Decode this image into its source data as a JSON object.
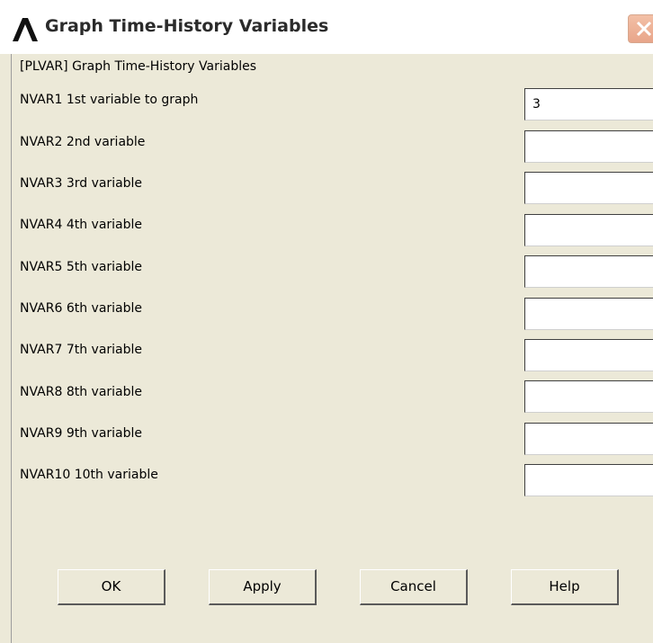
{
  "window": {
    "title": "Graph Time-History Variables"
  },
  "heading": "[PLVAR]  Graph Time-History Variables",
  "fields": [
    {
      "label": "NVAR1   1st variable to graph",
      "value": "3"
    },
    {
      "label": "NVAR2   2nd variable",
      "value": ""
    },
    {
      "label": "NVAR3   3rd variable",
      "value": ""
    },
    {
      "label": "NVAR4   4th variable",
      "value": ""
    },
    {
      "label": "NVAR5   5th variable",
      "value": ""
    },
    {
      "label": "NVAR6   6th variable",
      "value": ""
    },
    {
      "label": "NVAR7   7th variable",
      "value": ""
    },
    {
      "label": "NVAR8   8th variable",
      "value": ""
    },
    {
      "label": "NVAR9   9th variable",
      "value": ""
    },
    {
      "label": "NVAR10  10th variable",
      "value": ""
    }
  ],
  "buttons": {
    "ok": "OK",
    "apply": "Apply",
    "cancel": "Cancel",
    "help": "Help"
  },
  "icons": {
    "logo": "ansys-lambda-logo-icon",
    "close": "close-icon"
  },
  "colors": {
    "logo": "#111111",
    "close_button": "#e8a58a",
    "background": "#ece9d8"
  }
}
